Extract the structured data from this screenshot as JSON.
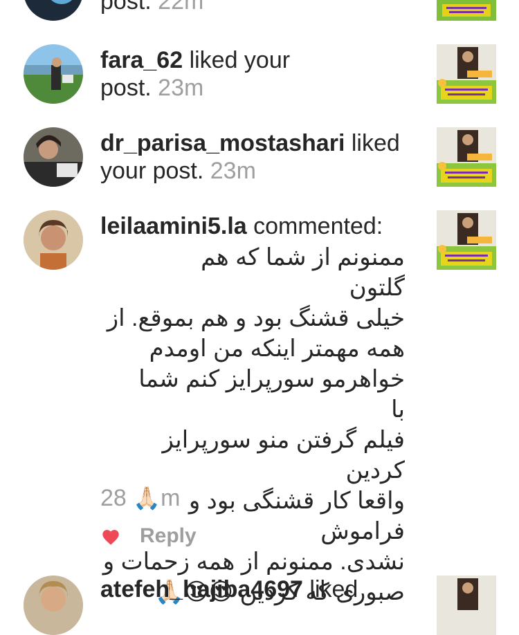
{
  "notifications": [
    {
      "username": "",
      "action_tail": "post.",
      "time": "22m"
    },
    {
      "username": "fara_62",
      "action": "liked your",
      "action_tail": "post.",
      "time": "23m"
    },
    {
      "username": "dr_parisa_mostashari",
      "action": "liked",
      "action_tail": "your post.",
      "time": "23m"
    },
    {
      "username": "leilaamini5.la",
      "action": "commented:",
      "comment_lines": [
        "ممنونم از شما که هم گلتون",
        "خیلی قشنگ بود و هم بموقع. از",
        "همه مهمتر اینکه من اومدم",
        "خواهرمو سورپرایز کنم شما با",
        "فیلم گرفتن منو سورپرایز کردین",
        "واقعا کار قشنگی بود و فراموش",
        "نشدی. ممنونم از همه زحمات و",
        "صبوری که کردین 😍😍🙏🏻"
      ],
      "time_prefix": "28",
      "time_emoji": "🙏🏻",
      "time_suffix": "m",
      "reply_label": "Reply"
    },
    {
      "username": "atefeh_hajiba4697",
      "action": "liked"
    }
  ],
  "colors": {
    "primary_text": "#262626",
    "secondary_text": "#9e9e9e",
    "like_heart": "#ed4956"
  },
  "icons": {
    "like": "heart-icon"
  }
}
